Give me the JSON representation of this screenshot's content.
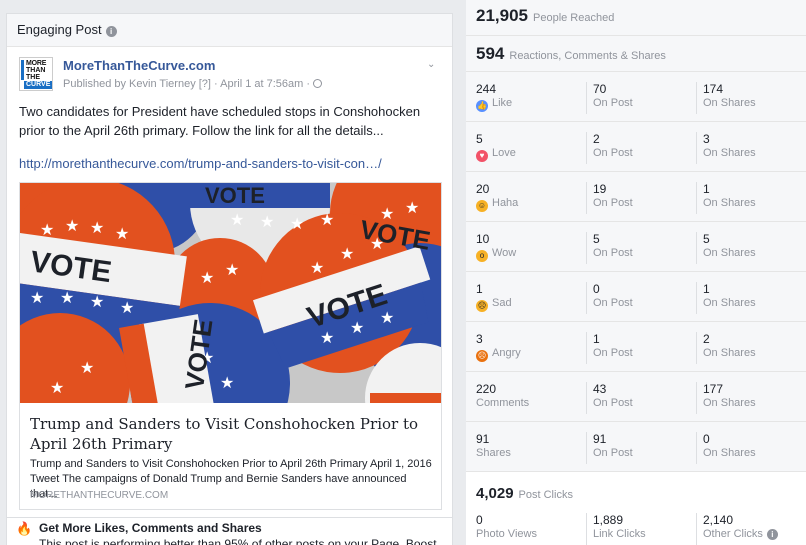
{
  "left": {
    "header": "Engaging Post",
    "post": {
      "logo_text": [
        "MORE",
        "THAN",
        "THE",
        "CURVE"
      ],
      "page_name": "MoreThanTheCurve.com",
      "published_line": "Published by Kevin Tierney [?] · April 1 at 7:56am · ",
      "text": "Two candidates for President have scheduled stops in Conshohocken prior to the April 26th primary. Follow the link for all the details...",
      "link": "http://morethanthecurve.com/trump-and-sanders-to-visit-con…/",
      "card": {
        "image_word": "VOTE",
        "title": "Trump and Sanders to Visit Conshohocken Prior to April 26th Primary",
        "description": "Trump and Sanders to Visit Conshohocken Prior to April 26th Primary April 1, 2016 Tweet The campaigns of Donald Trump and Bernie Sanders have announced that...",
        "domain": "MORETHANTHECURVE.COM"
      }
    },
    "tip": {
      "title": "Get More Likes, Comments and Shares",
      "text": "This post is performing better than 95% of other posts on your Page. Boost"
    }
  },
  "right": {
    "reached": {
      "value": "21,905",
      "label": "People Reached"
    },
    "engagement": {
      "value": "594",
      "label": "Reactions, Comments & Shares"
    },
    "rows": [
      {
        "total": "244",
        "label": "Like",
        "icon": "like-icon",
        "on_post": "70",
        "on_shares": "174"
      },
      {
        "total": "5",
        "label": "Love",
        "icon": "love-icon",
        "on_post": "2",
        "on_shares": "3"
      },
      {
        "total": "20",
        "label": "Haha",
        "icon": "haha-icon",
        "on_post": "19",
        "on_shares": "1"
      },
      {
        "total": "10",
        "label": "Wow",
        "icon": "wow-icon",
        "on_post": "5",
        "on_shares": "5"
      },
      {
        "total": "1",
        "label": "Sad",
        "icon": "sad-icon",
        "on_post": "0",
        "on_shares": "1"
      },
      {
        "total": "3",
        "label": "Angry",
        "icon": "angry-icon",
        "on_post": "1",
        "on_shares": "2"
      },
      {
        "total": "220",
        "label": "Comments",
        "icon": "",
        "on_post": "43",
        "on_shares": "177"
      },
      {
        "total": "91",
        "label": "Shares",
        "icon": "",
        "on_post": "91",
        "on_shares": "0"
      }
    ],
    "on_post_label": "On Post",
    "on_shares_label": "On Shares",
    "post_clicks": {
      "value": "4,029",
      "label": "Post Clicks"
    },
    "clicks": [
      {
        "value": "0",
        "label": "Photo Views"
      },
      {
        "value": "1,889",
        "label": "Link Clicks"
      },
      {
        "value": "2,140",
        "label": "Other Clicks"
      }
    ]
  },
  "colors": {
    "link": "#365899",
    "like": "#5890ff",
    "love": "#f25268",
    "haha": "#f7b125",
    "angry": "#e9710f"
  }
}
